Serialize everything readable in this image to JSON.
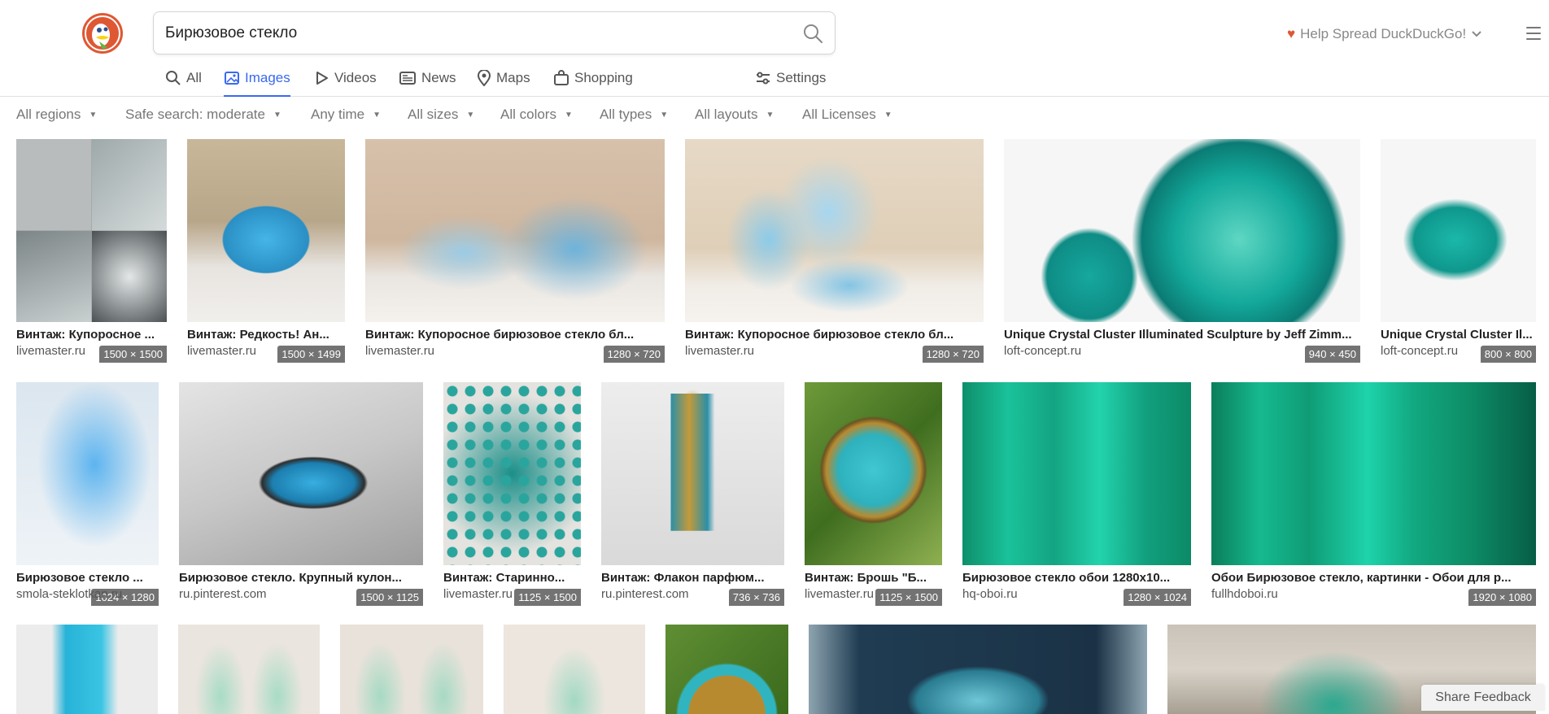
{
  "search": {
    "query": "Бирюзовое стекло"
  },
  "header": {
    "spread_label": "Help Spread DuckDuckGo!"
  },
  "tabs": [
    {
      "label": "All",
      "icon": "search-icon"
    },
    {
      "label": "Images",
      "icon": "image-icon",
      "active": true
    },
    {
      "label": "Videos",
      "icon": "play-icon"
    },
    {
      "label": "News",
      "icon": "news-icon"
    },
    {
      "label": "Maps",
      "icon": "map-pin-icon"
    },
    {
      "label": "Shopping",
      "icon": "shopping-bag-icon"
    },
    {
      "label": "Settings",
      "icon": "settings-sliders-icon"
    }
  ],
  "filters": [
    "All regions",
    "Safe search: moderate",
    "Any time",
    "All sizes",
    "All colors",
    "All types",
    "All layouts",
    "All Licenses"
  ],
  "results_row1": [
    {
      "title": "Винтаж: Купоросное ...",
      "source": "livemaster.ru",
      "dims": "1500 × 1500"
    },
    {
      "title": "Винтаж: Редкость! Ан...",
      "source": "livemaster.ru",
      "dims": "1500 × 1499"
    },
    {
      "title": "Винтаж: Купоросное бирюзовое стекло бл...",
      "source": "livemaster.ru",
      "dims": "1280 × 720"
    },
    {
      "title": "Винтаж: Купоросное бирюзовое стекло бл...",
      "source": "livemaster.ru",
      "dims": "1280 × 720"
    },
    {
      "title": "Unique Crystal Cluster Illuminated Sculpture by Jeff Zimm...",
      "source": "loft-concept.ru",
      "dims": "940 × 450"
    },
    {
      "title": "Unique Crystal Cluster Il...",
      "source": "loft-concept.ru",
      "dims": "800 × 800"
    }
  ],
  "results_row2": [
    {
      "title": "Бирюзовое стекло ...",
      "source": "smola-steklotkan.ru",
      "dims": "1024 × 1280"
    },
    {
      "title": "Бирюзовое стекло. Крупный кулон...",
      "source": "ru.pinterest.com",
      "dims": "1500 × 1125"
    },
    {
      "title": "Винтаж: Старинно...",
      "source": "livemaster.ru",
      "dims": "1125 × 1500"
    },
    {
      "title": "Винтаж: Флакон парфюм...",
      "source": "ru.pinterest.com",
      "dims": "736 × 736"
    },
    {
      "title": "Винтаж: Брошь \"Б...",
      "source": "livemaster.ru",
      "dims": "1125 × 1500"
    },
    {
      "title": "Бирюзовое стекло обои 1280x10...",
      "source": "hq-oboi.ru",
      "dims": "1280 × 1024"
    },
    {
      "title": "Обои Бирюзовое стекло, картинки - Обои для р...",
      "source": "fullhdoboi.ru",
      "dims": "1920 × 1080"
    }
  ],
  "feedback_label": "Share Feedback"
}
